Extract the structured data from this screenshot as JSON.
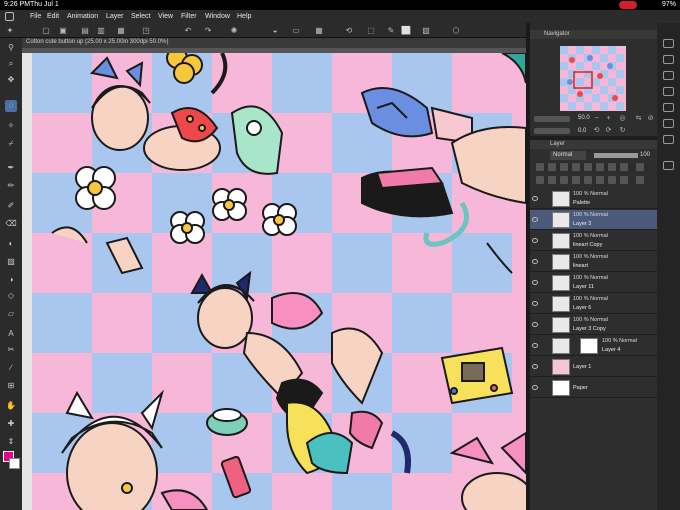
{
  "status_bar": {
    "time": "9:26 PM",
    "date": "Thu Jul 1",
    "battery": "97%"
  },
  "menu": {
    "items": [
      "File",
      "Edit",
      "Animation",
      "Layer",
      "Select",
      "View",
      "Filter",
      "Window",
      "Help"
    ]
  },
  "document": {
    "tab_title": "Cotton cute button up (25.00 x 25.00in 300dpi 50.0%)"
  },
  "navigator": {
    "title": "Navigator",
    "zoom": "50.0",
    "rotation": "0.0"
  },
  "layers": {
    "title": "Layer",
    "blend_mode": "Normal",
    "opacity": "100",
    "items": [
      {
        "mode": "100 % Normal",
        "name": "Palette"
      },
      {
        "mode": "100 % Normal",
        "name": "Layer 3"
      },
      {
        "mode": "100 % Normal",
        "name": "lineart Copy"
      },
      {
        "mode": "100 % Normal",
        "name": "lineart"
      },
      {
        "mode": "100 % Normal",
        "name": "Layer 11"
      },
      {
        "mode": "100 % Normal",
        "name": "Layer 6"
      },
      {
        "mode": "100 % Normal",
        "name": "Layer 3 Copy"
      },
      {
        "mode": "100 % Normal",
        "name": "Layer 4"
      },
      {
        "mode": "",
        "name": "Layer 1"
      },
      {
        "mode": "",
        "name": "Paper"
      }
    ]
  },
  "colors": {
    "foreground": "#e8008c",
    "background": "#ffffff",
    "accent": "#4a6fa5"
  }
}
